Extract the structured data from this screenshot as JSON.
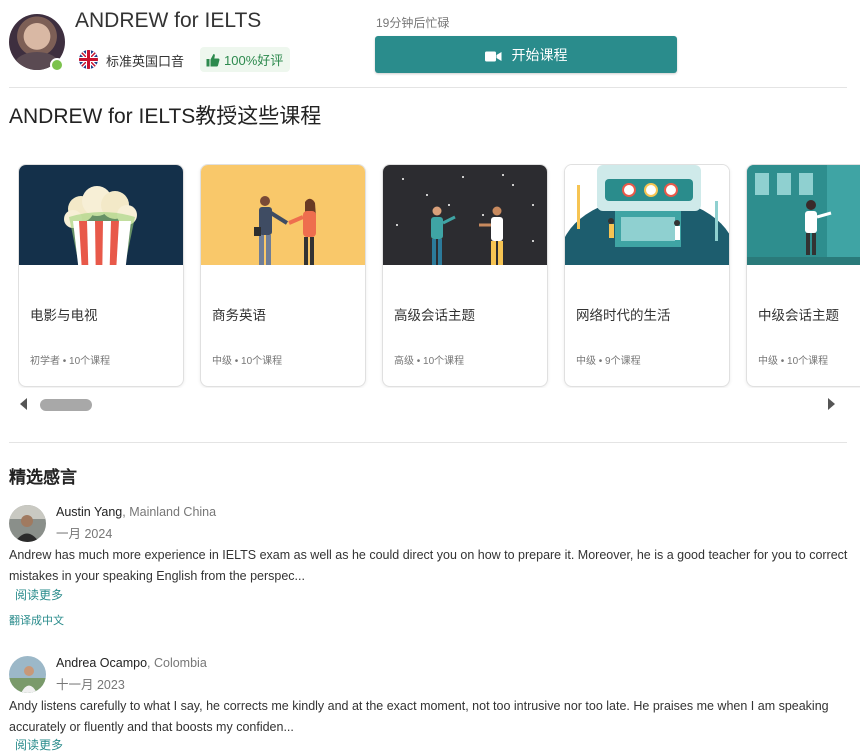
{
  "header": {
    "tutor_name": "ANDREW for IELTS",
    "accent": "标准英国口音",
    "rating": "100%好评",
    "busy_status": "19分钟后忙碌",
    "start_button": "开始课程"
  },
  "courses": {
    "title": "ANDREW for IELTS教授这些课程",
    "items": [
      {
        "title": "电影与电视",
        "meta": "初学者 • 10个课程"
      },
      {
        "title": "商务英语",
        "meta": "中级 • 10个课程"
      },
      {
        "title": "高级会话主题",
        "meta": "高级 • 10个课程"
      },
      {
        "title": "网络时代的生活",
        "meta": "中级 • 9个课程"
      },
      {
        "title": "中级会话主题",
        "meta": "中级 • 10个课程"
      }
    ]
  },
  "reviews": {
    "title": "精选感言",
    "items": [
      {
        "name": "Austin Yang",
        "country": ", Mainland China",
        "date": "一月 2024",
        "body": "Andrew has much more experience in IELTS exam as well as he could direct you on how to prepare it. Moreover, he is a good teacher for you to correct mistakes in your speaking English from the perspec...",
        "read_more": "阅读更多",
        "translate": "翻译成中文"
      },
      {
        "name": "Andrea Ocampo",
        "country": ", Colombia",
        "date": "十一月 2023",
        "body": "Andy listens carefully to what I say, he corrects me kindly and at the exact moment, not too intrusive nor too late. He praises me when I am speaking accurately or fluently and that boosts my confiden...",
        "read_more": "阅读更多"
      }
    ]
  },
  "colors": {
    "accent": "#2a8c8c",
    "online": "#7cc24d",
    "rating_green": "#2d8a4e"
  }
}
